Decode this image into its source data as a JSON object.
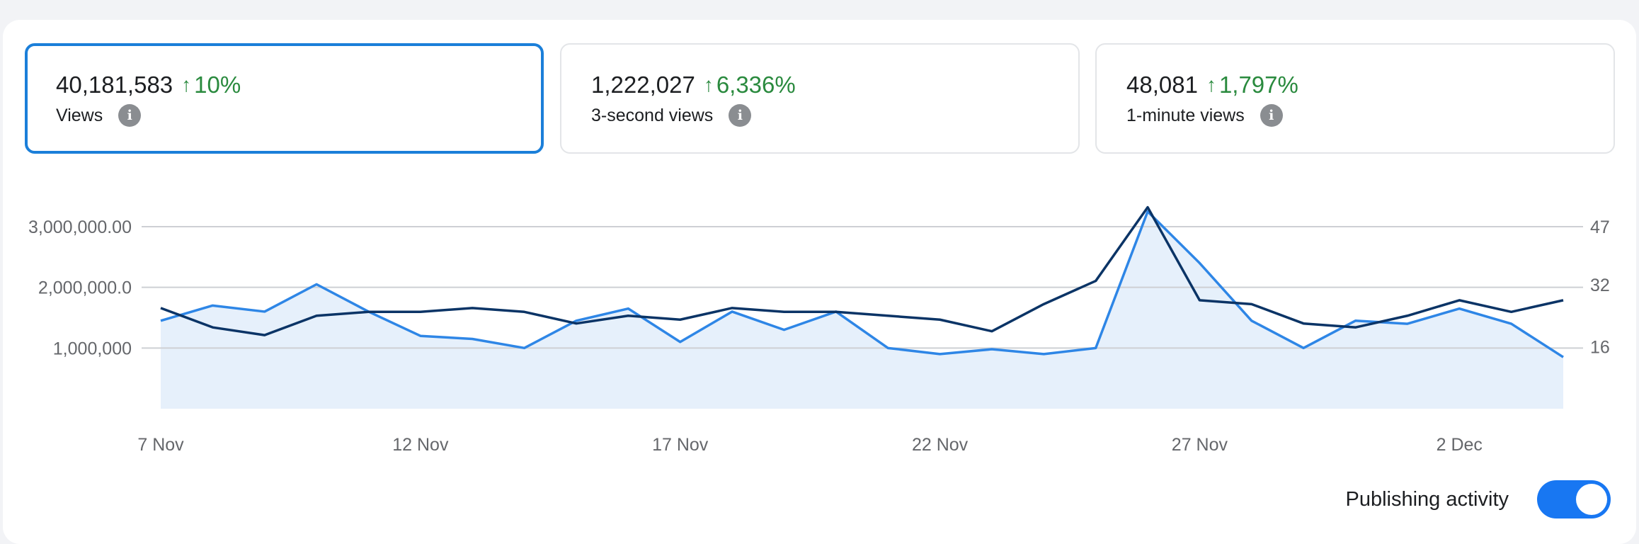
{
  "cards": [
    {
      "value": "40,181,583",
      "change": "10%",
      "label": "Views",
      "selected": true
    },
    {
      "value": "1,222,027",
      "change": "6,336%",
      "label": "3-second views",
      "selected": false
    },
    {
      "value": "48,081",
      "change": "1,797%",
      "label": "1-minute views",
      "selected": false
    }
  ],
  "icons": {
    "change": "arrow-up-icon",
    "info": "info-icon"
  },
  "colors": {
    "accent": "#1877f2",
    "positive": "#2a8a3e",
    "views_line": "#2e86e6",
    "area_fill": "#e6f0fb",
    "secondary_line": "#0b3466"
  },
  "toggle": {
    "label": "Publishing activity",
    "on": true
  },
  "chart_data": {
    "type": "line",
    "x": [
      "7 Nov",
      "8 Nov",
      "9 Nov",
      "10 Nov",
      "11 Nov",
      "12 Nov",
      "13 Nov",
      "14 Nov",
      "15 Nov",
      "16 Nov",
      "17 Nov",
      "18 Nov",
      "19 Nov",
      "20 Nov",
      "21 Nov",
      "22 Nov",
      "23 Nov",
      "24 Nov",
      "25 Nov",
      "26 Nov",
      "27 Nov",
      "28 Nov",
      "29 Nov",
      "30 Nov",
      "1 Dec",
      "2 Dec",
      "3 Dec",
      "4 Dec"
    ],
    "x_tick_labels": [
      "7 Nov",
      "12 Nov",
      "17 Nov",
      "22 Nov",
      "27 Nov",
      "2 Dec"
    ],
    "y_left_ticks": [
      {
        "value": 1000000,
        "label": "1,000,000"
      },
      {
        "value": 2000000,
        "label": "2,000,000.0"
      },
      {
        "value": 3000000,
        "label": "3,000,000.00"
      }
    ],
    "y_right_ticks": [
      {
        "value": 16,
        "label": "16"
      },
      {
        "value": 32,
        "label": "32"
      },
      {
        "value": 47,
        "label": "47"
      }
    ],
    "ylim_left": [
      0,
      3000000
    ],
    "ylim_right": [
      0,
      47
    ],
    "grid": true,
    "series": [
      {
        "axis": "left",
        "style": "area",
        "values": [
          1450000,
          1700000,
          1600000,
          2050000,
          1600000,
          1200000,
          1150000,
          1000000,
          1450000,
          1650000,
          1100000,
          1600000,
          1300000,
          1600000,
          1000000,
          900000,
          980000,
          900000,
          1000000,
          3250000,
          2400000,
          1450000,
          1000000,
          1450000,
          1400000,
          1650000,
          1400000,
          850000
        ]
      },
      {
        "axis": "right",
        "style": "line",
        "values": [
          26,
          21,
          19,
          24,
          25,
          25,
          26,
          25,
          22,
          24,
          23,
          26,
          25,
          25,
          24,
          23,
          20,
          27,
          33,
          52,
          28,
          27,
          22,
          21,
          24,
          28,
          25,
          28
        ]
      }
    ]
  }
}
